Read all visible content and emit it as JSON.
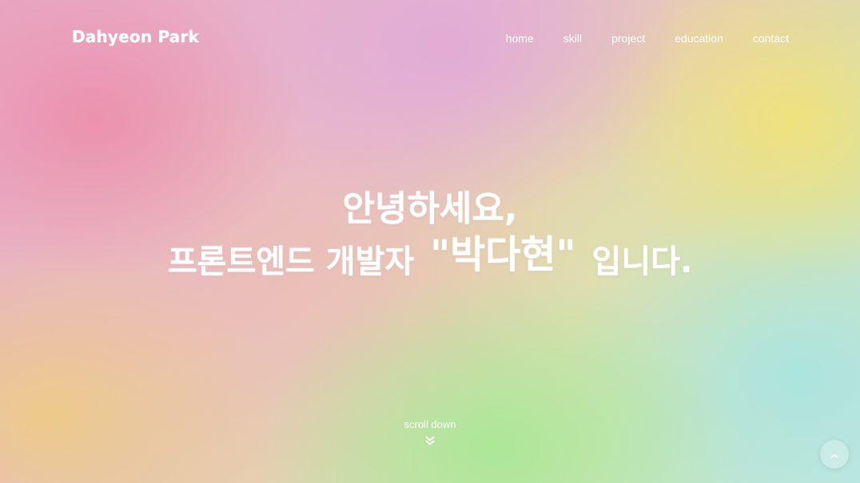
{
  "header": {
    "logo": "Dahyeon Park",
    "nav": [
      {
        "label": "home"
      },
      {
        "label": "skill"
      },
      {
        "label": "project"
      },
      {
        "label": "education"
      },
      {
        "label": "contact"
      }
    ]
  },
  "hero": {
    "line1": "안녕하세요,",
    "line2_prefix": "프론트엔드 개발자",
    "line2_name": "\"박다현\"",
    "line2_suffix": "입니다."
  },
  "scroll": {
    "label": "scroll down",
    "icon": "double-chevron-down-icon"
  },
  "back_to_top": {
    "icon": "chevron-up-icon"
  },
  "colors": {
    "text": "#ffffff",
    "pink": "#ec8caa",
    "lavender": "#e1aad7",
    "yellow": "#f2e278",
    "green": "#aae896",
    "cyan": "#aae4e1"
  }
}
